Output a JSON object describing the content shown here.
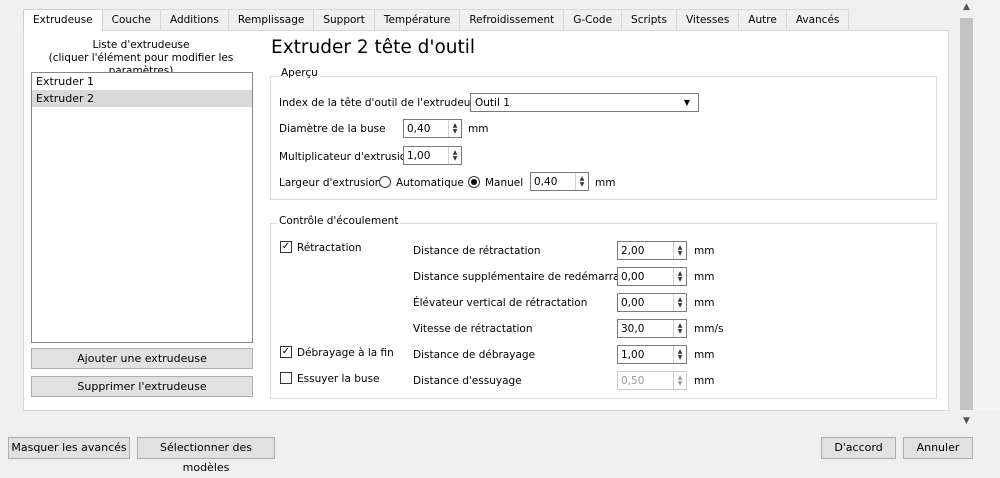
{
  "tabs": [
    "Extrudeuse",
    "Couche",
    "Additions",
    "Remplissage",
    "Support",
    "Température",
    "Refroidissement",
    "G-Code",
    "Scripts",
    "Vitesses",
    "Autre",
    "Avancés"
  ],
  "extruder_list": {
    "title_line1": "Liste d'extrudeuse",
    "title_line2": "(cliquer l'élément pour modifier les paramètres)",
    "items": [
      "Extruder 1",
      "Extruder 2"
    ],
    "selected": "Extruder 2"
  },
  "buttons": {
    "add_extruder": "Ajouter une extrudeuse",
    "remove_extruder": "Supprimer l'extrudeuse",
    "hide_advanced": "Masquer les avancés",
    "select_models": "Sélectionner des modèles",
    "ok": "D'accord",
    "cancel": "Annuler"
  },
  "heading": "Extruder 2 tête d'outil",
  "overview": {
    "title": "Aperçu",
    "toolhead_index_label": "Index de la tête d'outil de l'extrudeuse",
    "toolhead_index_value": "Outil 1",
    "nozzle_diameter_label": "Diamètre de la buse",
    "nozzle_diameter_value": "0,40",
    "nozzle_diameter_unit": "mm",
    "extrusion_multiplier_label": "Multiplicateur d'extrusion",
    "extrusion_multiplier_value": "1,00",
    "extrusion_width_label": "Largeur d'extrusion",
    "auto_label": "Automatique",
    "manual_label": "Manuel",
    "extrusion_width_value": "0,40",
    "extrusion_width_unit": "mm"
  },
  "flow_control": {
    "title": "Contrôle d'écoulement",
    "retraction_label": "Rétractation",
    "coast_label": "Débrayage à la fin",
    "wipe_label": "Essuyer la buse",
    "rows": [
      {
        "label": "Distance de rétractation",
        "value": "2,00",
        "unit": "mm"
      },
      {
        "label": "Distance supplémentaire de redémarrage",
        "value": "0,00",
        "unit": "mm"
      },
      {
        "label": "Élévateur vertical de rétractation",
        "value": "0,00",
        "unit": "mm"
      },
      {
        "label": "Vitesse de rétractation",
        "value": "30,0",
        "unit": "mm/s"
      },
      {
        "label": "Distance de débrayage",
        "value": "1,00",
        "unit": "mm"
      },
      {
        "label": "Distance d'essuyage",
        "value": "0,50",
        "unit": "mm"
      }
    ]
  },
  "icons": {
    "dropdown": "▼",
    "spin_up": "▲",
    "spin_down": "▼",
    "check": "✓",
    "scroll_up": "▲",
    "scroll_down": "▼"
  }
}
